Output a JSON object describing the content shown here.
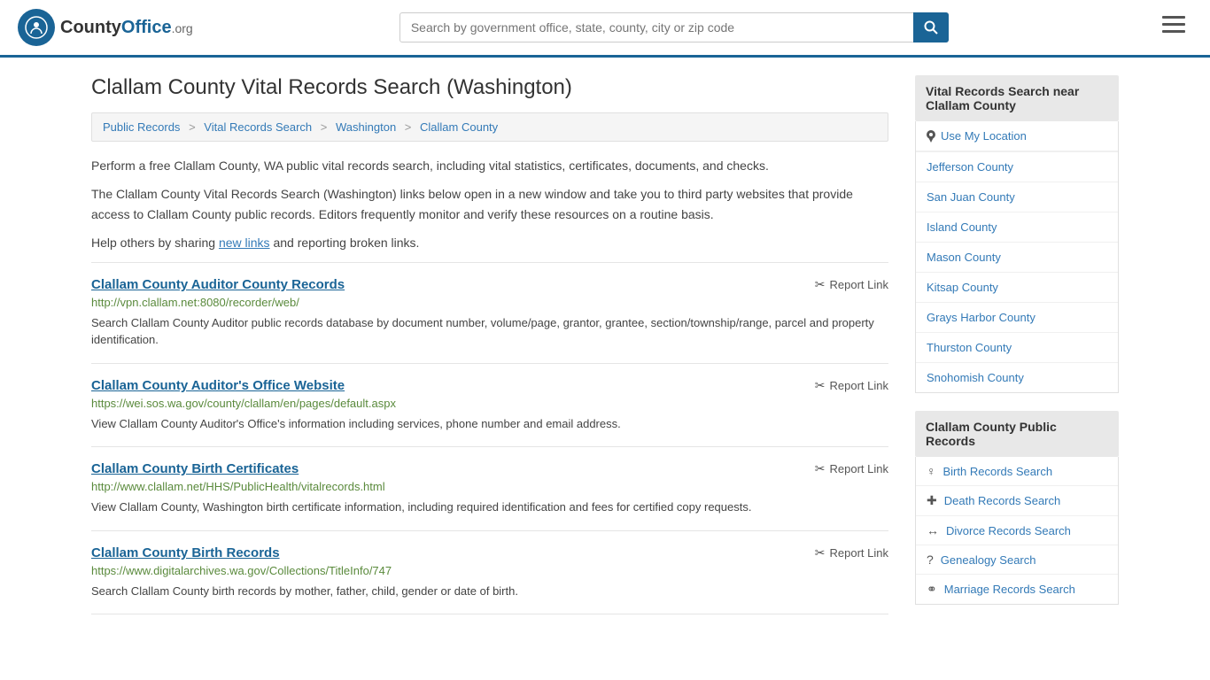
{
  "header": {
    "logo_text": "County",
    "logo_org": "Office",
    "logo_tld": ".org",
    "search_placeholder": "Search by government office, state, county, city or zip code"
  },
  "page": {
    "title": "Clallam County Vital Records Search (Washington)"
  },
  "breadcrumb": {
    "items": [
      {
        "label": "Public Records",
        "href": "#"
      },
      {
        "label": "Vital Records Search",
        "href": "#"
      },
      {
        "label": "Washington",
        "href": "#"
      },
      {
        "label": "Clallam County",
        "href": "#"
      }
    ]
  },
  "description": {
    "para1": "Perform a free Clallam County, WA public vital records search, including vital statistics, certificates, documents, and checks.",
    "para2": "The Clallam County Vital Records Search (Washington) links below open in a new window and take you to third party websites that provide access to Clallam County public records. Editors frequently monitor and verify these resources on a routine basis.",
    "para3_pre": "Help others by sharing ",
    "para3_link": "new links",
    "para3_post": " and reporting broken links."
  },
  "records": [
    {
      "title": "Clallam County Auditor County Records",
      "url": "http://vpn.clallam.net:8080/recorder/web/",
      "desc": "Search Clallam County Auditor public records database by document number, volume/page, grantor, grantee, section/township/range, parcel and property identification.",
      "report_label": "Report Link"
    },
    {
      "title": "Clallam County Auditor's Office Website",
      "url": "https://wei.sos.wa.gov/county/clallam/en/pages/default.aspx",
      "desc": "View Clallam County Auditor's Office's information including services, phone number and email address.",
      "report_label": "Report Link"
    },
    {
      "title": "Clallam County Birth Certificates",
      "url": "http://www.clallam.net/HHS/PublicHealth/vitalrecords.html",
      "desc": "View Clallam County, Washington birth certificate information, including required identification and fees for certified copy requests.",
      "report_label": "Report Link"
    },
    {
      "title": "Clallam County Birth Records",
      "url": "https://www.digitalarchives.wa.gov/Collections/TitleInfo/747",
      "desc": "Search Clallam County birth records by mother, father, child, gender or date of birth.",
      "report_label": "Report Link"
    }
  ],
  "sidebar": {
    "nearby_heading": "Vital Records Search near Clallam County",
    "use_location": "Use My Location",
    "nearby_counties": [
      "Jefferson County",
      "San Juan County",
      "Island County",
      "Mason County",
      "Kitsap County",
      "Grays Harbor County",
      "Thurston County",
      "Snohomish County"
    ],
    "public_records_heading": "Clallam County Public Records",
    "public_records": [
      {
        "icon": "♀",
        "label": "Birth Records Search"
      },
      {
        "icon": "+",
        "label": "Death Records Search"
      },
      {
        "icon": "↔",
        "label": "Divorce Records Search"
      },
      {
        "icon": "?",
        "label": "Genealogy Search"
      },
      {
        "icon": "⚭",
        "label": "Marriage Records Search"
      }
    ]
  }
}
